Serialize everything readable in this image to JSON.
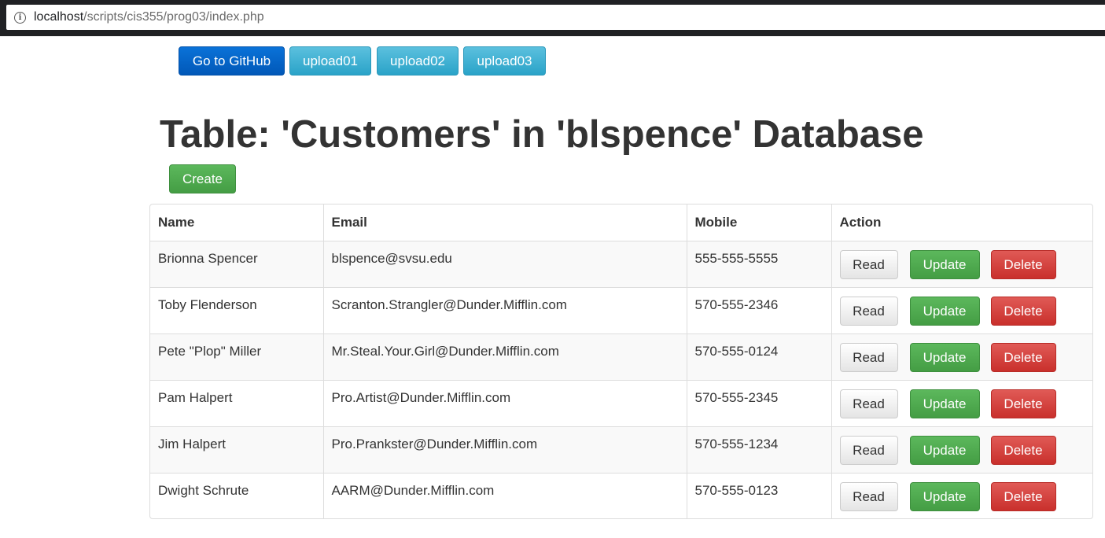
{
  "browser": {
    "info_glyph": "i",
    "url_host": "localhost",
    "url_path": "/scripts/cis355/prog03/index.php"
  },
  "top_nav": {
    "github_label": "Go to GitHub",
    "upload01_label": "upload01",
    "upload02_label": "upload02",
    "upload03_label": "upload03"
  },
  "page": {
    "title": "Table: 'Customers' in 'blspence' Database",
    "create_label": "Create"
  },
  "table": {
    "headers": {
      "name": "Name",
      "email": "Email",
      "mobile": "Mobile",
      "action": "Action"
    },
    "actions": {
      "read": "Read",
      "update": "Update",
      "delete": "Delete"
    },
    "rows": [
      {
        "name": "Brionna Spencer",
        "email": "blspence@svsu.edu",
        "mobile": "555-555-5555"
      },
      {
        "name": "Toby Flenderson",
        "email": "Scranton.Strangler@Dunder.Mifflin.com",
        "mobile": "570-555-2346"
      },
      {
        "name": "Pete \"Plop\" Miller",
        "email": "Mr.Steal.Your.Girl@Dunder.Mifflin.com",
        "mobile": "570-555-0124"
      },
      {
        "name": "Pam Halpert",
        "email": "Pro.Artist@Dunder.Mifflin.com",
        "mobile": "570-555-2345"
      },
      {
        "name": "Jim Halpert",
        "email": "Pro.Prankster@Dunder.Mifflin.com",
        "mobile": "570-555-1234"
      },
      {
        "name": "Dwight Schrute",
        "email": "AARM@Dunder.Mifflin.com",
        "mobile": "570-555-0123"
      }
    ]
  },
  "colors": {
    "primary": "#0158b8",
    "info": "#2aa3c8",
    "success": "#449d44",
    "danger": "#c9302c"
  }
}
